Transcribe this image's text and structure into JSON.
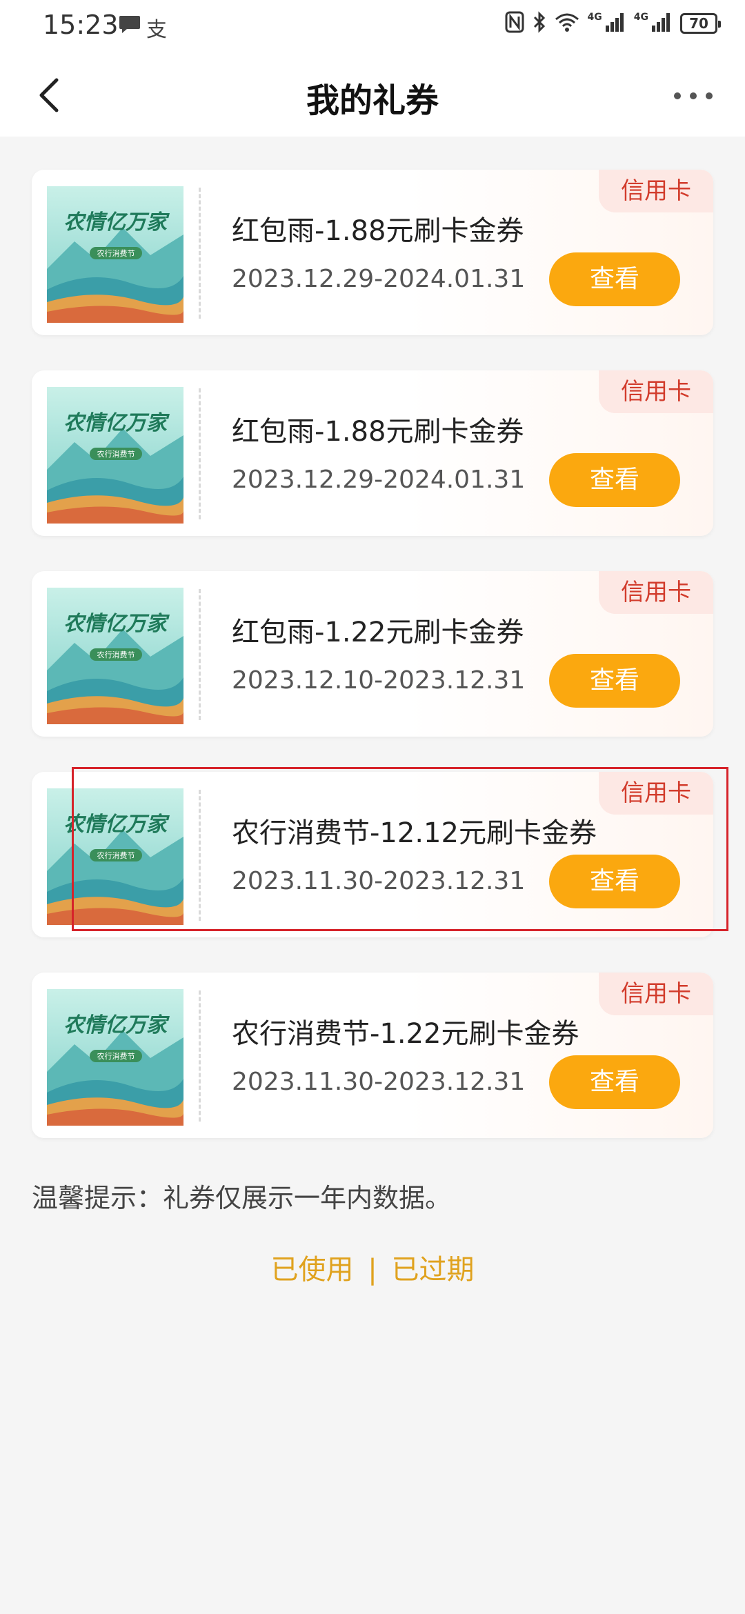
{
  "status_bar": {
    "time": "15:23",
    "pay_glyph": "支",
    "net1": "4G",
    "net2": "4G",
    "battery": "70"
  },
  "header": {
    "title": "我的礼券"
  },
  "coupons": [
    {
      "tag": "信用卡",
      "title": "红包雨-1.88元刷卡金券",
      "date": "2023.12.29-2024.01.31",
      "button": "查看"
    },
    {
      "tag": "信用卡",
      "title": "红包雨-1.88元刷卡金券",
      "date": "2023.12.29-2024.01.31",
      "button": "查看"
    },
    {
      "tag": "信用卡",
      "title": "红包雨-1.22元刷卡金券",
      "date": "2023.12.10-2023.12.31",
      "button": "查看"
    },
    {
      "tag": "信用卡",
      "title": "农行消费节-12.12元刷卡金券",
      "date": "2023.11.30-2023.12.31",
      "button": "查看"
    },
    {
      "tag": "信用卡",
      "title": "农行消费节-1.22元刷卡金券",
      "date": "2023.11.30-2023.12.31",
      "button": "查看"
    }
  ],
  "thumb_text": {
    "main": "农情亿万家",
    "sub": "农行消费节"
  },
  "footer": {
    "tip": "温馨提示：礼券仅展示一年内数据。",
    "used": "已使用",
    "separator": "|",
    "expired": "已过期"
  },
  "colors": {
    "accent": "#fba80f",
    "tag_bg": "#fde8e4",
    "tag_text": "#d23c2c",
    "link": "#e0a21e",
    "highlight_box": "#d6232a"
  }
}
